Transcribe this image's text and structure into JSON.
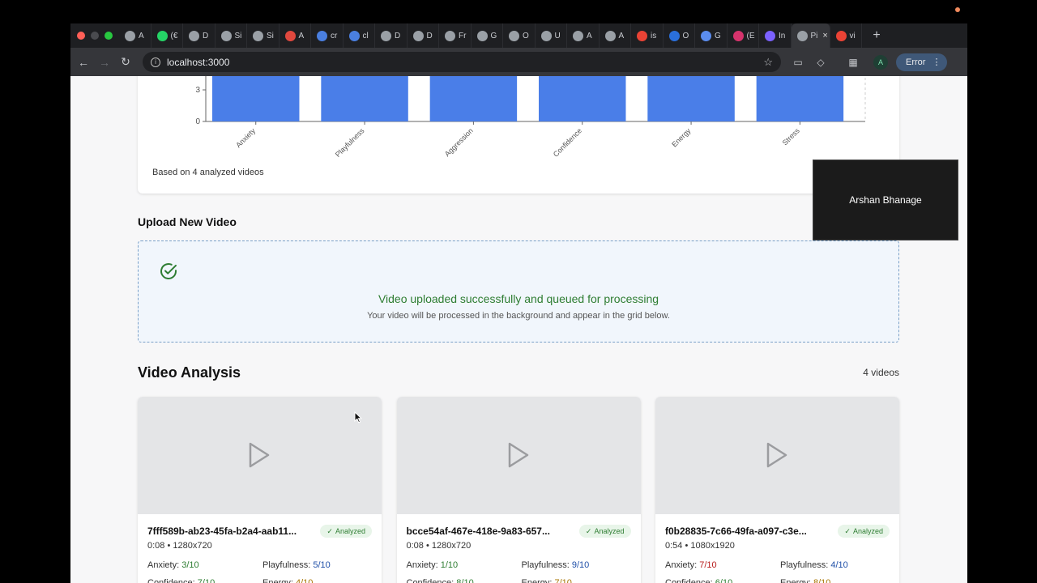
{
  "browser": {
    "tabs": [
      {
        "label": "A",
        "icon": "openai-icon",
        "color": "#9aa0a6"
      },
      {
        "label": "(€",
        "icon": "whatsapp-icon",
        "color": "#25d366"
      },
      {
        "label": "D",
        "icon": "vercel-icon",
        "color": "#9aa0a6"
      },
      {
        "label": "Si",
        "icon": "vercel-icon",
        "color": "#9aa0a6"
      },
      {
        "label": "Si",
        "icon": "squiggle-icon",
        "color": "#9aa0a6"
      },
      {
        "label": "A",
        "icon": "target-icon",
        "color": "#e0483e"
      },
      {
        "label": "cr",
        "icon": "docs-icon",
        "color": "#4a7fe0"
      },
      {
        "label": "cl",
        "icon": "docs-icon",
        "color": "#4a7fe0"
      },
      {
        "label": "D",
        "icon": "openai-icon",
        "color": "#9aa0a6"
      },
      {
        "label": "D",
        "icon": "vercel-icon",
        "color": "#9aa0a6"
      },
      {
        "label": "Fr",
        "icon": "openai-icon",
        "color": "#9aa0a6"
      },
      {
        "label": "G",
        "icon": "share-icon",
        "color": "#9aa0a6"
      },
      {
        "label": "O",
        "icon": "share-icon",
        "color": "#9aa0a6"
      },
      {
        "label": "U",
        "icon": "github-icon",
        "color": "#9aa0a6"
      },
      {
        "label": "A",
        "icon": "openai-icon",
        "color": "#9aa0a6"
      },
      {
        "label": "A",
        "icon": "github-icon",
        "color": "#9aa0a6"
      },
      {
        "label": "is",
        "icon": "google-icon",
        "color": "#ea4335"
      },
      {
        "label": "O",
        "icon": "edge-icon",
        "color": "#2a6fdb"
      },
      {
        "label": "G",
        "icon": "gemini-icon",
        "color": "#5b8def"
      },
      {
        "label": "(E",
        "icon": "instagram-icon",
        "color": "#d6336c"
      },
      {
        "label": "In",
        "icon": "diamond-icon",
        "color": "#7b61ff"
      },
      {
        "label": "Pi",
        "icon": "page-icon",
        "color": "#9aa0a6",
        "active": true
      },
      {
        "label": "vi",
        "icon": "google-icon",
        "color": "#ea4335"
      }
    ],
    "url": "localhost:3000",
    "profile_initial": "A",
    "error_label": "Error"
  },
  "chart": {
    "note": "Based on 4 analyzed videos",
    "bar_color": "#4a7ee8"
  },
  "chart_data": {
    "type": "bar",
    "categories": [
      "Anxiety",
      "Playfulness",
      "Aggression",
      "Confidence",
      "Energy",
      "Stress"
    ],
    "values": [
      6,
      6,
      6,
      6,
      6,
      6
    ],
    "y_ticks": [
      0,
      3
    ],
    "ylim": [
      0,
      6
    ],
    "title": "",
    "xlabel": "",
    "ylabel": ""
  },
  "upload": {
    "heading": "Upload New Video",
    "title": "Video uploaded successfully and queued for processing",
    "subtitle": "Your video will be processed in the background and appear in the grid below."
  },
  "analysis": {
    "heading": "Video Analysis",
    "count": "4 videos",
    "badge_label": "Analyzed",
    "videos": [
      {
        "id": "7fff589b-ab23-45fa-b2a4-aab11...",
        "meta": "0:08 • 1280x720",
        "metrics": [
          {
            "label": "Anxiety:",
            "value": "3/10",
            "tone": "green"
          },
          {
            "label": "Playfulness:",
            "value": "5/10",
            "tone": "blue"
          },
          {
            "label": "Confidence:",
            "value": "7/10",
            "tone": "green"
          },
          {
            "label": "Energy:",
            "value": "4/10",
            "tone": "orange"
          }
        ]
      },
      {
        "id": "bcce54af-467e-418e-9a83-657...",
        "meta": "0:08 • 1280x720",
        "metrics": [
          {
            "label": "Anxiety:",
            "value": "1/10",
            "tone": "green"
          },
          {
            "label": "Playfulness:",
            "value": "9/10",
            "tone": "blue"
          },
          {
            "label": "Confidence:",
            "value": "8/10",
            "tone": "green"
          },
          {
            "label": "Energy:",
            "value": "7/10",
            "tone": "orange"
          }
        ]
      },
      {
        "id": "f0b28835-7c66-49fa-a097-c3e...",
        "meta": "0:54 • 1080x1920",
        "metrics": [
          {
            "label": "Anxiety:",
            "value": "7/10",
            "tone": "red"
          },
          {
            "label": "Playfulness:",
            "value": "4/10",
            "tone": "blue"
          },
          {
            "label": "Confidence:",
            "value": "6/10",
            "tone": "green"
          },
          {
            "label": "Energy:",
            "value": "8/10",
            "tone": "orange"
          }
        ]
      }
    ]
  },
  "overlay": {
    "participant_name": "Arshan Bhanage"
  }
}
